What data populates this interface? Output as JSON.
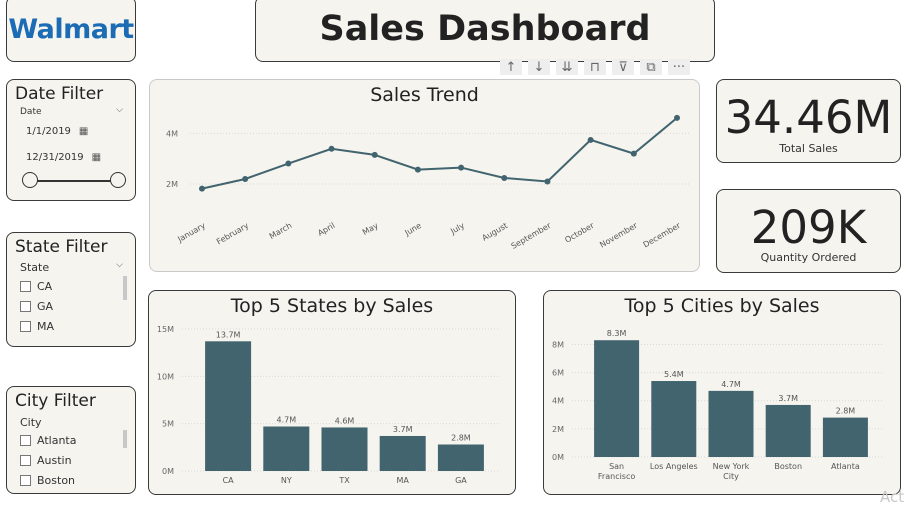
{
  "logo": {
    "text": "Walmart"
  },
  "header": {
    "title": "Sales Dashboard"
  },
  "toolbar": [
    {
      "icon": "arrow-up-icon",
      "glyph": "↑"
    },
    {
      "icon": "arrow-down-icon",
      "glyph": "↓"
    },
    {
      "icon": "double-arrow-down-icon",
      "glyph": "⇊"
    },
    {
      "icon": "expand-icon",
      "glyph": "⊓"
    },
    {
      "icon": "filter-icon",
      "glyph": "⊽"
    },
    {
      "icon": "focus-mode-icon",
      "glyph": "⧉"
    },
    {
      "icon": "more-options-icon",
      "glyph": "···"
    }
  ],
  "date_filter": {
    "title": "Date Filter",
    "field": "Date",
    "start": "1/1/2019",
    "end": "12/31/2019",
    "range_fraction": [
      0,
      1
    ]
  },
  "state_filter": {
    "title": "State Filter",
    "field": "State",
    "items": [
      "CA",
      "GA",
      "MA"
    ]
  },
  "city_filter": {
    "title": "City Filter",
    "field": "City",
    "items": [
      "Atlanta",
      "Austin",
      "Boston"
    ]
  },
  "kpis": {
    "total_sales": {
      "value": "34.46M",
      "label": "Total Sales"
    },
    "quantity": {
      "value": "209K",
      "label": "Quantity Ordered"
    }
  },
  "chart_data": [
    {
      "type": "line",
      "title": "Sales Trend",
      "categories": [
        "January",
        "February",
        "March",
        "April",
        "May",
        "June",
        "July",
        "August",
        "September",
        "October",
        "November",
        "December"
      ],
      "values": [
        1.82,
        2.2,
        2.81,
        3.39,
        3.15,
        2.57,
        2.65,
        2.24,
        2.1,
        3.74,
        3.2,
        4.61
      ],
      "yticks": [
        {
          "v": 2,
          "label": "2M"
        },
        {
          "v": 4,
          "label": "4M"
        }
      ],
      "ylim": [
        0.7,
        5.0
      ],
      "color": "#41646e",
      "grid": true
    },
    {
      "type": "bar",
      "title": "Top 5 States by Sales",
      "categories": [
        "CA",
        "NY",
        "TX",
        "MA",
        "GA"
      ],
      "values": [
        13.7,
        4.7,
        4.6,
        3.7,
        2.8
      ],
      "data_labels": [
        "13.7M",
        "4.7M",
        "4.6M",
        "3.7M",
        "2.8M"
      ],
      "yticks": [
        {
          "v": 0,
          "label": "0M"
        },
        {
          "v": 5,
          "label": "5M"
        },
        {
          "v": 10,
          "label": "10M"
        },
        {
          "v": 15,
          "label": "15M"
        }
      ],
      "ylim": [
        0,
        15
      ],
      "color": "#41646e",
      "grid": true
    },
    {
      "type": "bar",
      "title": "Top 5 Cities by Sales",
      "categories": [
        [
          "San",
          "Francisco"
        ],
        [
          "Los Angeles"
        ],
        [
          "New York",
          "City"
        ],
        [
          "Boston"
        ],
        [
          "Atlanta"
        ]
      ],
      "values": [
        8.3,
        5.4,
        4.7,
        3.7,
        2.8
      ],
      "data_labels": [
        "8.3M",
        "5.4M",
        "4.7M",
        "3.7M",
        "2.8M"
      ],
      "yticks": [
        {
          "v": 0,
          "label": "0M"
        },
        {
          "v": 2,
          "label": "2M"
        },
        {
          "v": 4,
          "label": "4M"
        },
        {
          "v": 6,
          "label": "6M"
        },
        {
          "v": 8,
          "label": "8M"
        }
      ],
      "ylim": [
        0,
        8.6
      ],
      "color": "#41646e",
      "grid": true
    }
  ],
  "watermark": "Act"
}
